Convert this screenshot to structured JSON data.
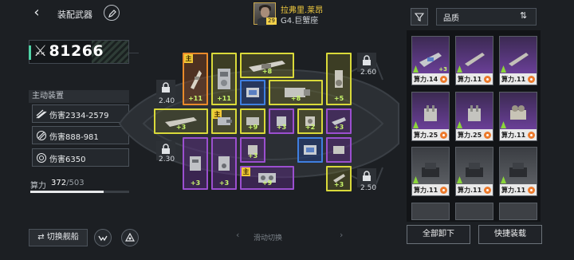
{
  "header": {
    "back_icon": "chevron-left-icon",
    "title": "装配武器",
    "edit_icon": "pencil-icon"
  },
  "captain": {
    "name": "拉弗里.莱昂",
    "level": "29",
    "ship": "G4.巨蟹座"
  },
  "left_panel": {
    "power": "81266",
    "power_icon": "crossed-swords-icon",
    "active_gear_label": "主动装置",
    "skills": [
      {
        "icon": "missile-icon",
        "text": "伤害2334-2579"
      },
      {
        "icon": "shells-icon",
        "text": "伤害888-981"
      },
      {
        "icon": "shield-target-icon",
        "text": "伤害6350"
      }
    ],
    "calc_label": "算力",
    "calc_current": "372",
    "calc_max": "/503",
    "calc_fraction": 0.74,
    "switch_ship_label": "切换舰船"
  },
  "grid": {
    "locks": [
      {
        "text": "2.40"
      },
      {
        "text": "2.60"
      },
      {
        "text": "2.30"
      },
      {
        "text": "2.50"
      }
    ],
    "main_tag": "主",
    "slots": [
      {
        "lv": "+11"
      },
      {
        "lv": "+11"
      },
      {
        "lv": ""
      },
      {
        "lv": "+8"
      },
      {
        "lv": "+8"
      },
      {
        "lv": "+5"
      },
      {
        "lv": "+3"
      },
      {
        "lv": "+9"
      },
      {
        "lv": "+3"
      },
      {
        "lv": "+2"
      },
      {
        "lv": "+3"
      },
      {
        "lv": "+3"
      },
      {
        "lv": "+3"
      },
      {
        "lv": "+3"
      },
      {
        "lv": ""
      },
      {
        "lv": ""
      },
      {
        "lv": "+3"
      },
      {
        "lv": "+9"
      },
      {
        "lv": "+3"
      }
    ],
    "swipe_hint": "滑动切换"
  },
  "inventory": {
    "filter_icon": "filter-icon",
    "sort_label": "品质",
    "sort_icon": "sort-toggle-icon",
    "cards": [
      {
        "calc": "算力.14",
        "plus": "+3",
        "tier": "purple"
      },
      {
        "calc": "算力.11",
        "plus": "",
        "tier": "purple"
      },
      {
        "calc": "算力.11",
        "plus": "",
        "tier": "purple"
      },
      {
        "calc": "算力.25",
        "plus": "",
        "tier": "purple"
      },
      {
        "calc": "算力.25",
        "plus": "",
        "tier": "purple"
      },
      {
        "calc": "算力.11",
        "plus": "",
        "tier": "purple"
      },
      {
        "calc": "算力.11",
        "plus": "",
        "tier": "black"
      },
      {
        "calc": "算力.11",
        "plus": "",
        "tier": "black"
      },
      {
        "calc": "算力.11",
        "plus": "",
        "tier": "black"
      }
    ],
    "unequip_all_label": "全部卸下",
    "quick_equip_label": "快捷装载"
  }
}
